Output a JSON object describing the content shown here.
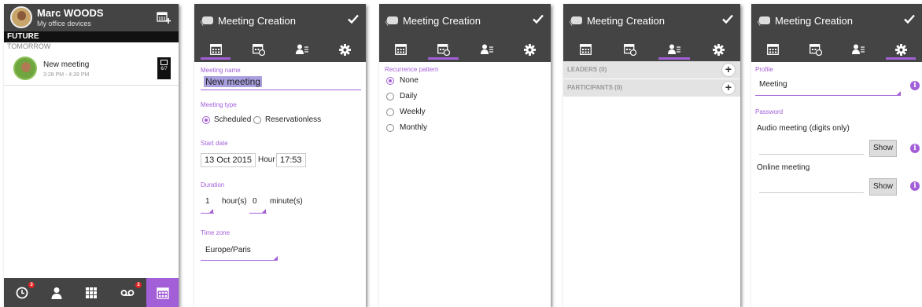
{
  "panel1": {
    "user_name": "Marc WOODS",
    "user_subtitle": "My office devices",
    "section_future": "FUTURE",
    "section_tomorrow": "TOMORROW",
    "meeting_title": "New meeting",
    "meeting_time": "3:28 PM - 4:28 PM",
    "meeting_badge": "6/7",
    "badges": {
      "history": "3",
      "voicemail": "2"
    },
    "accent": "#a35fd7"
  },
  "creation": {
    "back": "〈",
    "title": "Meeting Creation"
  },
  "general": {
    "name_label": "Meeting name",
    "name_value": "New meeting",
    "type_label": "Meeting type",
    "type_scheduled": "Scheduled",
    "type_reservationless": "Reservationless",
    "start_label": "Start date",
    "start_date": "13 Oct 2015",
    "hour_label": "Hour",
    "hour_value": "17:53",
    "duration_label": "Duration",
    "duration_hours": "1",
    "hours_unit": "hour(s)",
    "duration_minutes": "0",
    "minutes_unit": "minute(s)",
    "timezone_label": "Time zone",
    "timezone_value": "Europe/Paris"
  },
  "recurrence": {
    "label": "Recurrence pattern",
    "options": [
      "None",
      "Daily",
      "Weekly",
      "Monthly"
    ]
  },
  "participants": {
    "leaders": "LEADERS (0)",
    "participants": "PARTICIPANTS (0)",
    "add": "+"
  },
  "settings": {
    "profile_label": "Profile",
    "profile_value": "Meeting",
    "password_label": "Password",
    "audio_label": "Audio meeting (digits only)",
    "online_label": "Online meeting",
    "show": "Show",
    "info": "i"
  }
}
